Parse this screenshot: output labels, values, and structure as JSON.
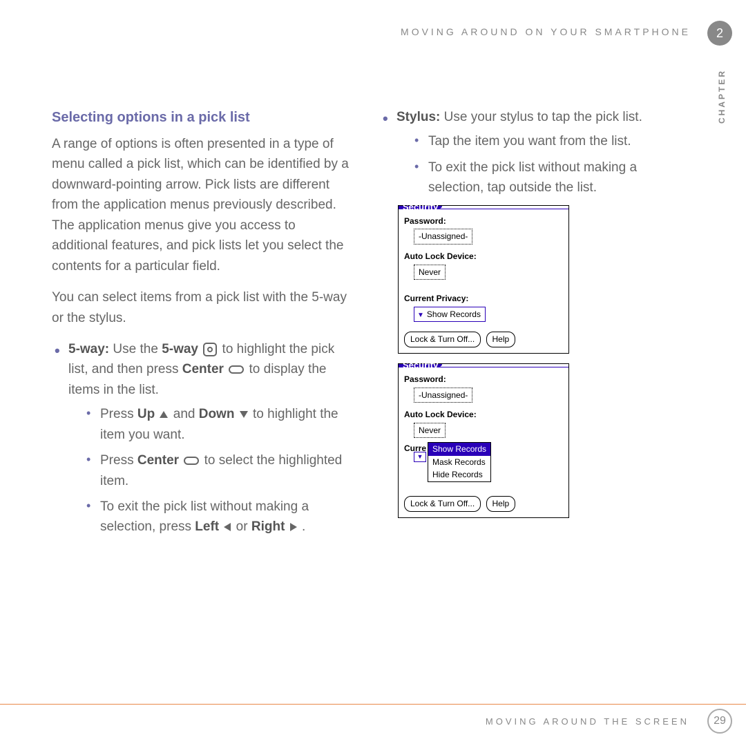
{
  "header": {
    "running_title": "MOVING AROUND ON YOUR SMARTPHONE",
    "chapter_num": "2",
    "chapter_label": "CHAPTER"
  },
  "left": {
    "heading": "Selecting options in a pick list",
    "para1": "A range of options is often presented in a type of menu called a pick list, which can be identified by a downward-pointing arrow. Pick lists are different from the application menus previously described. The application menus give you access to additional features, and pick lists let you select the contents for a particular field.",
    "para2": "You can select items from a pick list with the 5-way or the stylus.",
    "bullet_5way_label": "5-way:",
    "bullet_5way_pre": " Use the ",
    "bullet_5way_bold2": "5-way",
    "bullet_5way_mid": " to highlight the pick list, and then press ",
    "bullet_5way_center": "Center",
    "bullet_5way_end": " to display the items in the list.",
    "sub1_pre": "Press ",
    "sub1_up": "Up",
    "sub1_and": " and ",
    "sub1_down": "Down",
    "sub1_end": " to highlight the item you want.",
    "sub2_pre": "Press ",
    "sub2_center": "Center",
    "sub2_end": " to select the highlighted item.",
    "sub3_pre": "To exit the pick list without making a selection, press ",
    "sub3_left": "Left",
    "sub3_or": " or ",
    "sub3_right": "Right",
    "sub3_end": " ."
  },
  "right": {
    "bullet_stylus_label": "Stylus:",
    "bullet_stylus_text": " Use your stylus to tap the pick list.",
    "sub1": "Tap the item you want from the list.",
    "sub2": "To exit the pick list without making a selection, tap outside the list."
  },
  "palm": {
    "title": "Security",
    "password_label": "Password:",
    "password_value": "-Unassigned-",
    "autolock_label": "Auto Lock Device:",
    "autolock_value": "Never",
    "privacy_label": "Current Privacy:",
    "privacy_value": "Show Records",
    "privacy_truncated": "Curre",
    "menu_items": [
      "Show Records",
      "Mask Records",
      "Hide Records"
    ],
    "btn_lock": "Lock & Turn Off...",
    "btn_help": "Help"
  },
  "footer": {
    "text": "MOVING AROUND THE SCREEN",
    "page": "29"
  }
}
